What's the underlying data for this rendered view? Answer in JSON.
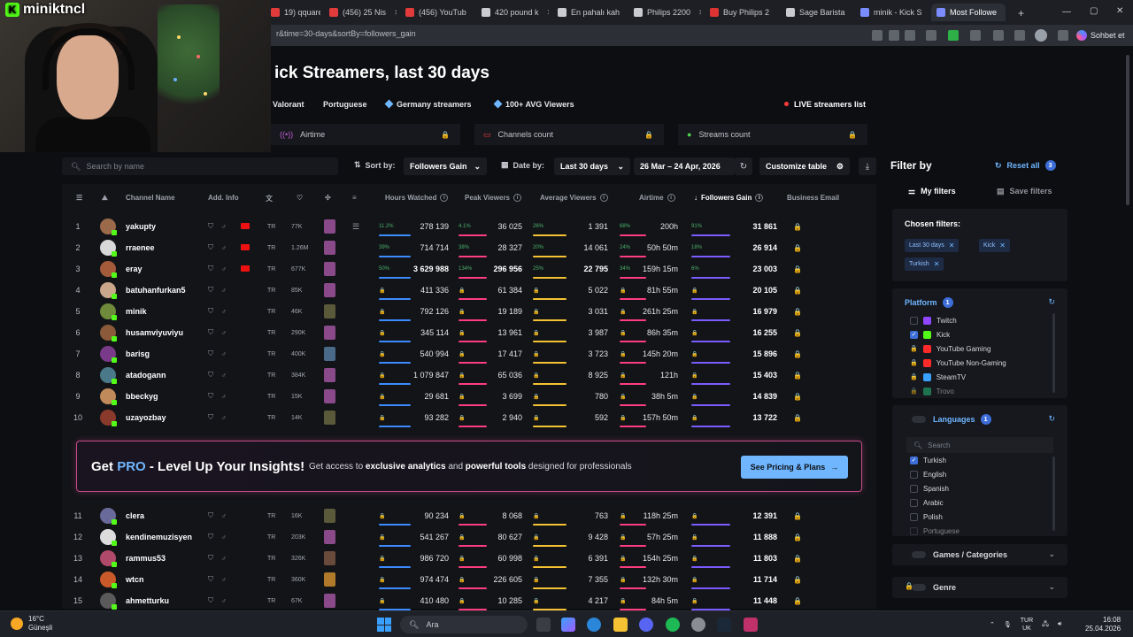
{
  "browser": {
    "tabs": [
      {
        "label": "19) qquares",
        "color": "#e23b3b"
      },
      {
        "label": "(456) 25 Nis",
        "color": "#e23b3b"
      },
      {
        "label": "(456) YouTub",
        "color": "#e23b3b"
      },
      {
        "label": "420 pound k",
        "color": "#c9cbd0"
      },
      {
        "label": "En pahalı kah",
        "color": "#c9cbd0"
      },
      {
        "label": "Philips 2200",
        "color": "#c9cbd0"
      },
      {
        "label": "Buy Philips 2",
        "color": "#d33"
      },
      {
        "label": "Sage Barista",
        "color": "#c9cbd0"
      },
      {
        "label": "minik - Kick S",
        "color": "#7b8cff"
      },
      {
        "label": "Most Followe",
        "color": "#7b8cff"
      }
    ],
    "url": "r&time=30-days&sortBy=followers_gain",
    "chat_label": "Sohbet et"
  },
  "webcam": {
    "streamer_name": "miniktncl"
  },
  "page": {
    "title": "ick Streamers, last 30 days",
    "chips": [
      "Valorant",
      "Portuguese",
      "Germany streamers",
      "100+ AVG Viewers"
    ],
    "live_chip": "LIVE streamers list",
    "metric_tabs": [
      "Airtime",
      "Channels count",
      "Streams count"
    ]
  },
  "toolbar": {
    "search_placeholder": "Search by name",
    "sort_label": "Sort by:",
    "sort_value": "Followers Gain",
    "date_label": "Date by:",
    "date_value": "Last 30 days",
    "date_range": "26 Mar – 24 Apr, 2026",
    "customize_label": "Customize table"
  },
  "table": {
    "headers": {
      "channel_name": "Channel Name",
      "add_info": "Add. Info",
      "hours_watched": "Hours Watched",
      "peak_viewers": "Peak Viewers",
      "average_viewers": "Average Viewers",
      "airtime": "Airtime",
      "followers_gain": "Followers Gain",
      "business_email": "Business Email"
    },
    "rows": [
      {
        "rank": "1",
        "name": "yakupty",
        "lang": "TR",
        "followers": "77K",
        "hours": "278 139",
        "peak": "36 025",
        "avg": "1 391",
        "air": "200h",
        "gain": "31 861",
        "hp": "11.2%",
        "pp": "4.1%",
        "ap": "26%",
        "airp": "68%",
        "gp": "91%",
        "flag": true,
        "av": "#9a6a4a",
        "cat": "#8a4a8a"
      },
      {
        "rank": "2",
        "name": "rraenee",
        "lang": "TR",
        "followers": "1.26M",
        "hours": "714 714",
        "peak": "28 327",
        "avg": "14 061",
        "air": "50h 50m",
        "gain": "26 914",
        "hp": "39%",
        "pp": "38%",
        "ap": "20%",
        "airp": "24%",
        "gp": "18%",
        "flag": true,
        "av": "#d8d8d8",
        "cat": "#8a4a8a"
      },
      {
        "rank": "3",
        "name": "eray",
        "lang": "TR",
        "followers": "677K",
        "hours": "3 629 988",
        "peak": "296 956",
        "avg": "22 795",
        "air": "159h 15m",
        "gain": "23 003",
        "hp": "50%",
        "pp": "134%",
        "ap": "25%",
        "airp": "34%",
        "gp": "6%",
        "flag": true,
        "bold": true,
        "av": "#a35b3a",
        "cat": "#8a4a8a"
      },
      {
        "rank": "4",
        "name": "batuhanfurkan5",
        "lang": "TR",
        "followers": "85K",
        "hours": "411 336",
        "peak": "61 384",
        "avg": "5 022",
        "air": "81h 55m",
        "gain": "20 105",
        "av": "#caa68a",
        "cat": "#8a4a8a"
      },
      {
        "rank": "5",
        "name": "minik",
        "lang": "TR",
        "followers": "46K",
        "hours": "792 126",
        "peak": "19 189",
        "avg": "3 031",
        "air": "261h 25m",
        "gain": "16 979",
        "av": "#6f8a3a",
        "cat": "#5a5a3a"
      },
      {
        "rank": "6",
        "name": "husamviyuviyu",
        "lang": "TR",
        "followers": "290K",
        "hours": "345 114",
        "peak": "13 961",
        "avg": "3 987",
        "air": "86h 35m",
        "gain": "16 255",
        "av": "#8a5a3a",
        "cat": "#8a4a8a"
      },
      {
        "rank": "7",
        "name": "barisg",
        "lang": "TR",
        "followers": "400K",
        "hours": "540 994",
        "peak": "17 417",
        "avg": "3 723",
        "air": "145h 20m",
        "gain": "15 896",
        "av": "#7a3a8a",
        "cat": "#4a6a8a"
      },
      {
        "rank": "8",
        "name": "atadogann",
        "lang": "TR",
        "followers": "384K",
        "hours": "1 079 847",
        "peak": "65 036",
        "avg": "8 925",
        "air": "121h",
        "gain": "15 403",
        "av": "#4a7a8a",
        "cat": "#8a4a8a"
      },
      {
        "rank": "9",
        "name": "bbeckyg",
        "lang": "TR",
        "followers": "15K",
        "hours": "29 681",
        "peak": "3 699",
        "avg": "780",
        "air": "38h 5m",
        "gain": "14 839",
        "av": "#c08a5a",
        "cat": "#8a4a8a"
      },
      {
        "rank": "10",
        "name": "uzayozbay",
        "lang": "TR",
        "followers": "14K",
        "hours": "93 282",
        "peak": "2 940",
        "avg": "592",
        "air": "157h 50m",
        "gain": "13 722",
        "av": "#8a3a2a",
        "cat": "#5a5a3a"
      },
      {
        "rank": "11",
        "name": "clera",
        "lang": "TR",
        "followers": "16K",
        "hours": "90 234",
        "peak": "8 068",
        "avg": "763",
        "air": "118h 25m",
        "gain": "12 391",
        "av": "#6a6a9a",
        "cat": "#5a5a3a"
      },
      {
        "rank": "12",
        "name": "kendinemuzisyen",
        "lang": "TR",
        "followers": "203K",
        "hours": "541 267",
        "peak": "80 627",
        "avg": "9 428",
        "air": "57h 25m",
        "gain": "11 888",
        "av": "#ddd",
        "cat": "#8a4a8a"
      },
      {
        "rank": "13",
        "name": "rammus53",
        "lang": "TR",
        "followers": "326K",
        "hours": "986 720",
        "peak": "60 998",
        "avg": "6 391",
        "air": "154h 25m",
        "gain": "11 803",
        "av": "#b04a6a",
        "cat": "#6a4a3a"
      },
      {
        "rank": "14",
        "name": "wtcn",
        "lang": "TR",
        "followers": "360K",
        "hours": "974 474",
        "peak": "226 605",
        "avg": "7 355",
        "air": "132h 30m",
        "gain": "11 714",
        "av": "#c85a2a",
        "cat": "#b07a2a"
      },
      {
        "rank": "15",
        "name": "ahmetturku",
        "lang": "TR",
        "followers": "67K",
        "hours": "410 480",
        "peak": "10 285",
        "avg": "4 217",
        "air": "84h 5m",
        "gain": "11 448",
        "av": "#5a5a5a",
        "cat": "#8a4a8a"
      }
    ]
  },
  "promo": {
    "title_get": "Get",
    "title_pro": "PRO",
    "title_rest": "- Level Up Your Insights!",
    "text_a": "Get access to",
    "text_b": "exclusive analytics",
    "text_c": "and",
    "text_d": "powerful tools",
    "text_e": "designed for professionals",
    "button": "See Pricing & Plans"
  },
  "filters": {
    "title": "Filter by",
    "reset_label": "Reset all",
    "reset_count": "3",
    "tab_my": "My filters",
    "tab_save": "Save filters",
    "chosen_title": "Chosen filters:",
    "chosen": [
      "Last 30 days",
      "Kick",
      "Turkish"
    ],
    "platform_title": "Platform",
    "platform_count": "1",
    "platforms": [
      {
        "label": "Twitch",
        "checked": false,
        "locked": false,
        "color": "#9146ff"
      },
      {
        "label": "Kick",
        "checked": true,
        "locked": false,
        "color": "#53fc18"
      },
      {
        "label": "YouTube Gaming",
        "checked": false,
        "locked": true,
        "color": "#ff2a2a"
      },
      {
        "label": "YouTube Non-Gaming",
        "checked": false,
        "locked": true,
        "color": "#ff2a2a"
      },
      {
        "label": "SteamTV",
        "checked": false,
        "locked": true,
        "color": "#3aa0ff"
      },
      {
        "label": "Trovo",
        "checked": false,
        "locked": true,
        "color": "#27c07a"
      }
    ],
    "languages_title": "Languages",
    "languages_count": "1",
    "language_search": "Search",
    "languages": [
      {
        "label": "Turkish",
        "checked": true
      },
      {
        "label": "English",
        "checked": false
      },
      {
        "label": "Spanish",
        "checked": false
      },
      {
        "label": "Arabic",
        "checked": false
      },
      {
        "label": "Polish",
        "checked": false
      },
      {
        "label": "Portuguese",
        "checked": false
      }
    ],
    "games_title": "Games / Categories",
    "genre_title": "Genre"
  },
  "taskbar": {
    "temp": "16°C",
    "weather": "Güneşli",
    "search": "Ara",
    "lang_top": "TUR",
    "lang_bottom": "UK",
    "time": "16:08",
    "date": "25.04.2026"
  }
}
